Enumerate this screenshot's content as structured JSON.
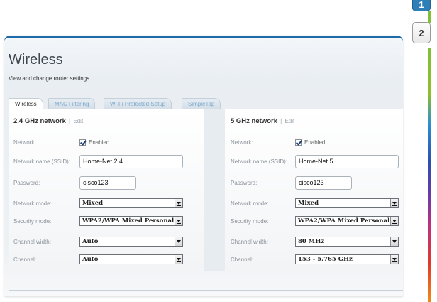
{
  "steps": [
    "1",
    "2"
  ],
  "header": {
    "title": "Wireless",
    "subtitle": "View and change router settings"
  },
  "tabs": [
    {
      "label": "Wireless",
      "active": true
    },
    {
      "label": "MAC Filtering",
      "active": false
    },
    {
      "label": "Wi-Fi Protected Setup",
      "active": false
    },
    {
      "label": "SimpleTap",
      "active": false
    }
  ],
  "bands": {
    "b24": {
      "heading": "2.4 GHz network",
      "edit": "Edit",
      "network_label": "Network:",
      "network_value": "Enabled",
      "ssid_label": "Network name (SSID):",
      "ssid": "Home-Net 2.4",
      "password_label": "Password:",
      "password": "cisco123",
      "mode_label": "Network mode:",
      "mode": "Mixed",
      "security_label": "Security mode:",
      "security": "WPA2/WPA Mixed Personal",
      "width_label": "Channel width:",
      "width": "Auto",
      "channel_label": "Channel:",
      "channel": "Auto"
    },
    "b5": {
      "heading": "5 GHz network",
      "edit": "Edit",
      "network_label": "Network:",
      "network_value": "Enabled",
      "ssid_label": "Network name (SSID):",
      "ssid": "Home-Net 5",
      "password_label": "Password:",
      "password": "cisco123",
      "mode_label": "Network mode:",
      "mode": "Mixed",
      "security_label": "Security mode:",
      "security": "WPA2/WPA Mixed Personal",
      "width_label": "Channel width:",
      "width": "80 MHz",
      "channel_label": "Channel:",
      "channel": "153 - 5.765 GHz"
    }
  },
  "colors": {
    "accent": "#1f6aa8",
    "tab_inactive_text": "#7aa8cc",
    "step_active": "#2e7fb8"
  }
}
